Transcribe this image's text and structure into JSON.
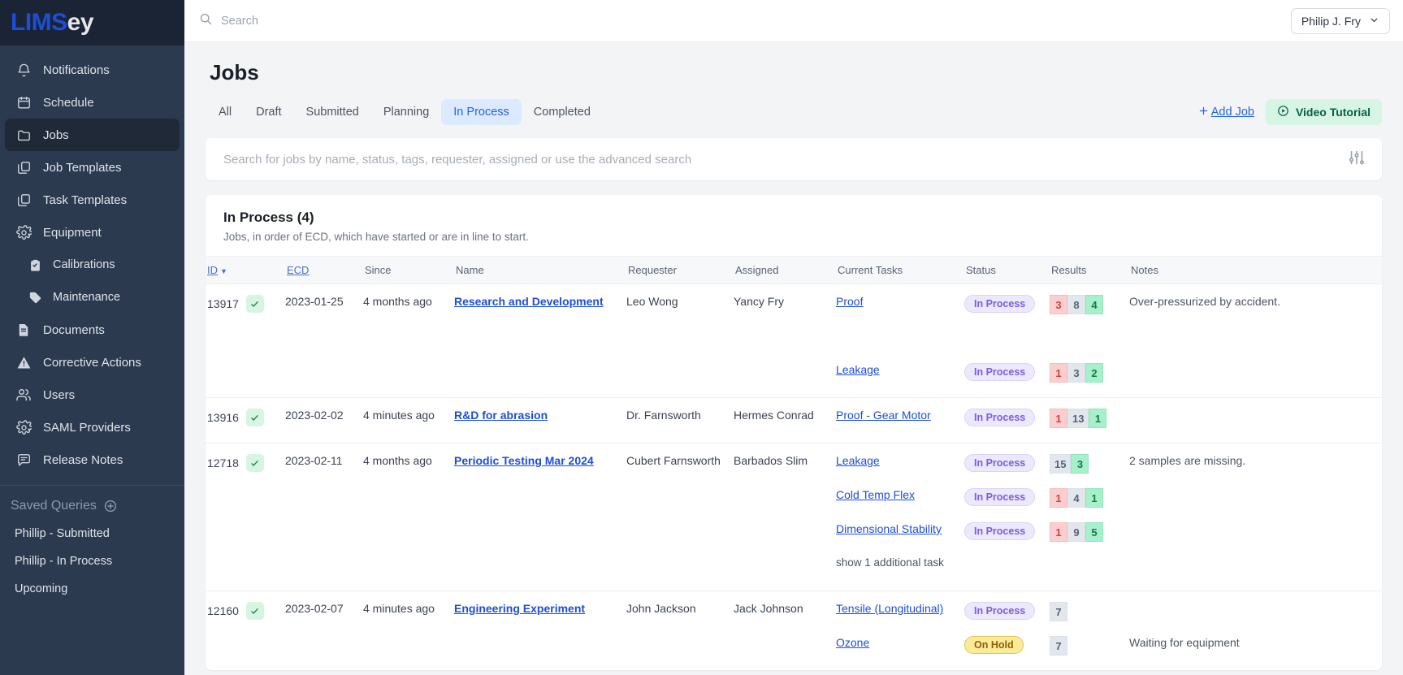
{
  "brand": {
    "part1": "LIMS",
    "part2": "ey"
  },
  "sidebar": {
    "items": [
      {
        "label": "Notifications",
        "icon": "bell-icon",
        "sub": false,
        "active": false
      },
      {
        "label": "Schedule",
        "icon": "calendar-icon",
        "sub": false,
        "active": false
      },
      {
        "label": "Jobs",
        "icon": "folder-icon",
        "sub": false,
        "active": true
      },
      {
        "label": "Job Templates",
        "icon": "copy-icon",
        "sub": false,
        "active": false
      },
      {
        "label": "Task Templates",
        "icon": "copy-icon",
        "sub": false,
        "active": false
      },
      {
        "label": "Equipment",
        "icon": "gear-icon",
        "sub": false,
        "active": false
      },
      {
        "label": "Calibrations",
        "icon": "clipboard-check-icon",
        "sub": true,
        "active": false
      },
      {
        "label": "Maintenance",
        "icon": "tag-icon",
        "sub": true,
        "active": false
      },
      {
        "label": "Documents",
        "icon": "document-icon",
        "sub": false,
        "active": false
      },
      {
        "label": "Corrective Actions",
        "icon": "warning-triangle-icon",
        "sub": false,
        "active": false
      },
      {
        "label": "Users",
        "icon": "users-icon",
        "sub": false,
        "active": false
      },
      {
        "label": "SAML Providers",
        "icon": "gear-icon",
        "sub": false,
        "active": false
      },
      {
        "label": "Release Notes",
        "icon": "chat-icon",
        "sub": false,
        "active": false
      }
    ],
    "saved_queries_title": "Saved Queries",
    "saved_queries": [
      {
        "label": "Phillip - Submitted"
      },
      {
        "label": "Phillip - In Process"
      },
      {
        "label": "Upcoming"
      }
    ]
  },
  "topbar": {
    "search_label": "Search",
    "user_name": "Philip J. Fry"
  },
  "page": {
    "title": "Jobs",
    "tabs": [
      {
        "label": "All",
        "active": false
      },
      {
        "label": "Draft",
        "active": false
      },
      {
        "label": "Submitted",
        "active": false
      },
      {
        "label": "Planning",
        "active": false
      },
      {
        "label": "In Process",
        "active": true
      },
      {
        "label": "Completed",
        "active": false
      }
    ],
    "add_job_label": "Add Job",
    "video_tutorial_label": "Video Tutorial",
    "search_placeholder": "Search for jobs by name, status, tags, requester, assigned or use the advanced search",
    "search_value": ""
  },
  "table": {
    "heading": "In Process (4)",
    "subheading": "Jobs, in order of ECD, which have started or are in line to start.",
    "columns": [
      {
        "label": "ID",
        "link": true,
        "sorted": true
      },
      {
        "label": "ECD",
        "link": true,
        "sorted": false
      },
      {
        "label": "Since",
        "link": false,
        "sorted": false
      },
      {
        "label": "Name",
        "link": false,
        "sorted": false
      },
      {
        "label": "Requester",
        "link": false,
        "sorted": false
      },
      {
        "label": "Assigned",
        "link": false,
        "sorted": false
      },
      {
        "label": "Current Tasks",
        "link": false,
        "sorted": false
      },
      {
        "label": "Status",
        "link": false,
        "sorted": false
      },
      {
        "label": "Results",
        "link": false,
        "sorted": false
      },
      {
        "label": "Notes",
        "link": false,
        "sorted": false
      }
    ],
    "rows": [
      {
        "id": "13917",
        "ecd": "2023-01-25",
        "since": "4 months ago",
        "name": "Research and Development",
        "requester": "Leo Wong",
        "assigned": "Yancy Fry",
        "notes": "Over-pressurized by accident.",
        "tasks": [
          {
            "label": "Proof",
            "link": true,
            "status": "In Process",
            "status_kind": "inprocess",
            "results": [
              {
                "v": "3",
                "k": "red"
              },
              {
                "v": "8",
                "k": "gray"
              },
              {
                "v": "4",
                "k": "green"
              }
            ]
          },
          {
            "label": "",
            "link": false,
            "status": "",
            "status_kind": "",
            "results": []
          },
          {
            "label": "Leakage",
            "link": true,
            "status": "In Process",
            "status_kind": "inprocess",
            "results": [
              {
                "v": "1",
                "k": "red"
              },
              {
                "v": "3",
                "k": "gray"
              },
              {
                "v": "2",
                "k": "green"
              }
            ]
          }
        ]
      },
      {
        "id": "13916",
        "ecd": "2023-02-02",
        "since": "4 minutes ago",
        "name": "R&D for abrasion",
        "requester": "Dr. Farnsworth",
        "assigned": "Hermes Conrad",
        "notes": "",
        "tasks": [
          {
            "label": "Proof - Gear Motor",
            "link": true,
            "status": "In Process",
            "status_kind": "inprocess",
            "results": [
              {
                "v": "1",
                "k": "red"
              },
              {
                "v": "13",
                "k": "gray"
              },
              {
                "v": "1",
                "k": "green"
              }
            ]
          }
        ]
      },
      {
        "id": "12718",
        "ecd": "2023-02-11",
        "since": "4 months ago",
        "name": "Periodic Testing Mar 2024",
        "requester": "Cubert Farnsworth",
        "assigned": "Barbados Slim",
        "notes": "2 samples are missing.",
        "tasks": [
          {
            "label": "Leakage",
            "link": true,
            "status": "In Process",
            "status_kind": "inprocess",
            "results": [
              {
                "v": "15",
                "k": "gray"
              },
              {
                "v": "3",
                "k": "green"
              }
            ]
          },
          {
            "label": "Cold Temp Flex",
            "link": true,
            "status": "In Process",
            "status_kind": "inprocess",
            "results": [
              {
                "v": "1",
                "k": "red"
              },
              {
                "v": "4",
                "k": "gray"
              },
              {
                "v": "1",
                "k": "green"
              }
            ]
          },
          {
            "label": "Dimensional Stability",
            "link": true,
            "status": "In Process",
            "status_kind": "inprocess",
            "results": [
              {
                "v": "1",
                "k": "red"
              },
              {
                "v": "9",
                "k": "gray"
              },
              {
                "v": "5",
                "k": "green"
              }
            ]
          },
          {
            "label": "show 1 additional task",
            "link": false,
            "status": "",
            "status_kind": "",
            "results": []
          }
        ]
      },
      {
        "id": "12160",
        "ecd": "2023-02-07",
        "since": "4 minutes ago",
        "name": "Engineering Experiment",
        "requester": "John Jackson",
        "assigned": "Jack Johnson",
        "notes": "",
        "tasks": [
          {
            "label": "Tensile (Longitudinal)",
            "link": true,
            "status": "In Process",
            "status_kind": "inprocess",
            "results": [
              {
                "v": "7",
                "k": "gray"
              }
            ]
          },
          {
            "label": "Ozone",
            "link": true,
            "status": "On Hold",
            "status_kind": "onhold",
            "results": [
              {
                "v": "7",
                "k": "gray"
              }
            ],
            "note": "Waiting for equipment"
          }
        ]
      }
    ]
  },
  "colors": {
    "sidebar_bg": "#2b3a4f",
    "logo_blue": "#1d4ed8",
    "accent_blue": "#2563eb",
    "tab_active_bg": "#dbeafe",
    "video_btn_bg": "#d6f5e3",
    "status_inprocess_bg": "#ece9fd",
    "status_onhold_bg": "#fcea9b"
  }
}
